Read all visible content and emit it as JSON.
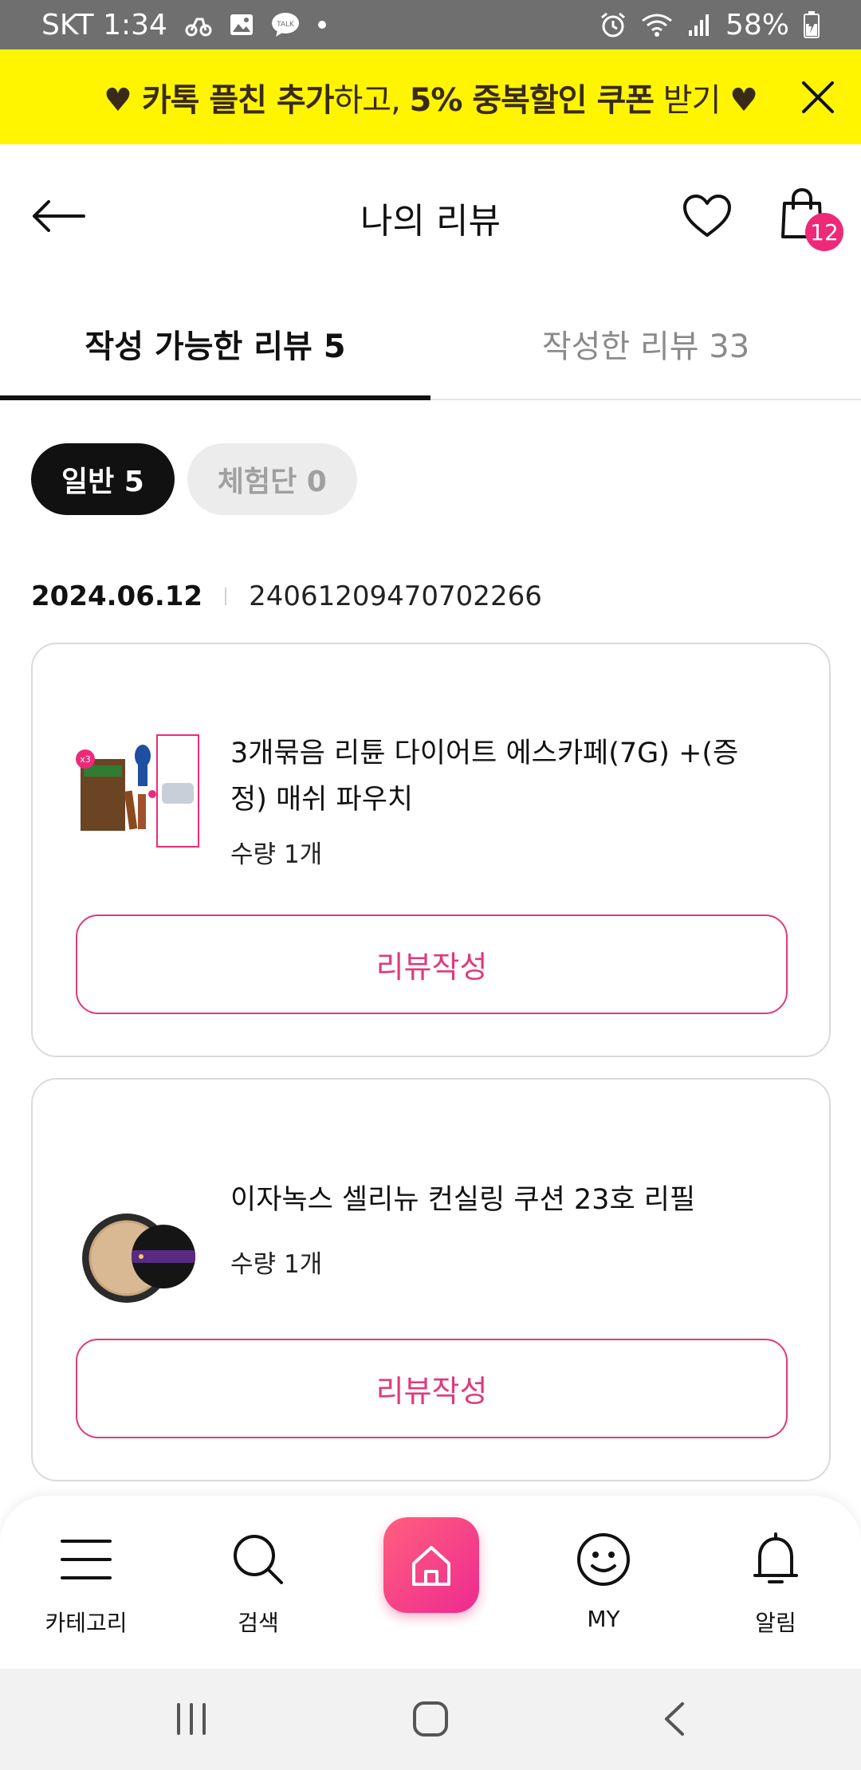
{
  "status_bar": {
    "carrier_time": "SKT 1:34",
    "battery": "58%"
  },
  "promo": {
    "text_bold_1": "♥ 카톡 플친 추가",
    "text_1": "하고, ",
    "text_bold_2": "5% 중복할인 쿠폰",
    "text_2": " 받기 ♥"
  },
  "header": {
    "title": "나의 리뷰",
    "cart_count": "12"
  },
  "tabs": [
    {
      "label": "작성 가능한 리뷰 5",
      "active": true
    },
    {
      "label": "작성한 리뷰 33",
      "active": false
    }
  ],
  "filters": [
    {
      "label": "일반 5",
      "active": true
    },
    {
      "label": "체험단 0",
      "active": false
    }
  ],
  "order": {
    "date": "2024.06.12",
    "number": "24061209470702266"
  },
  "items": [
    {
      "name": "3개묶음 리튠 다이어트 에스카페(7G) +(증정) 매쉬 파우치",
      "qty_label": "수량",
      "qty_value": "1개",
      "button": "리뷰작성"
    },
    {
      "name": "이자녹스 셀리뉴 컨실링 쿠션 23호 리필",
      "qty_label": "수량",
      "qty_value": "1개",
      "button": "리뷰작성"
    }
  ],
  "bottom_nav": {
    "category": "카테고리",
    "search": "검색",
    "my": "MY",
    "alarm": "알림"
  },
  "colors": {
    "accent": "#e0397d",
    "banner": "#fff500",
    "badge": "#ee2a78"
  }
}
